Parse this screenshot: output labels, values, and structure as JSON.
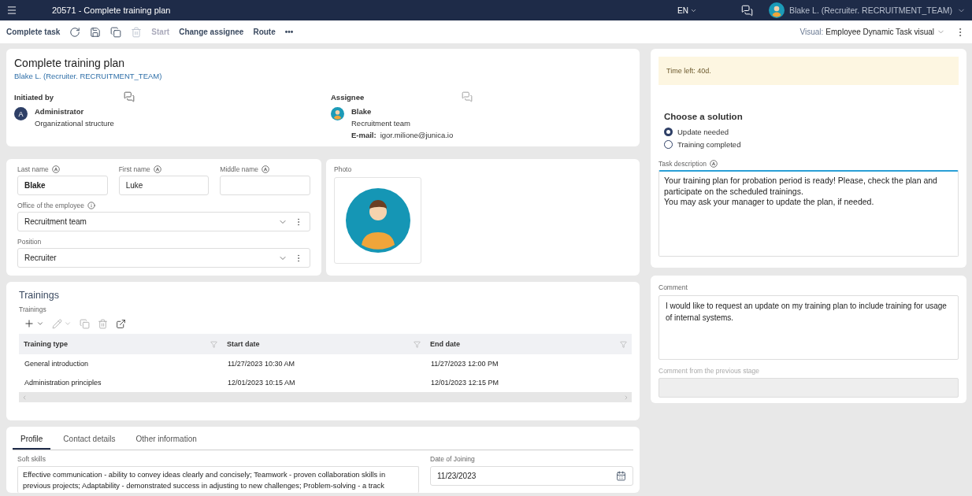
{
  "header": {
    "title": "20571 - Complete training plan",
    "language": "EN",
    "user": "Blake L. (Recruiter. RECRUITMENT_TEAM)"
  },
  "toolbar": {
    "primary": "Complete task",
    "icons": [
      {
        "disabled": false
      },
      {
        "disabled": false
      },
      {
        "disabled": false
      },
      {
        "disabled": true
      }
    ],
    "actions": [
      {
        "label": "Start",
        "disabled": true
      },
      {
        "label": "Change assignee",
        "disabled": false
      },
      {
        "label": "Route",
        "disabled": false
      }
    ],
    "more": "•••",
    "visual_label": "Visual:",
    "visual_value": "Employee Dynamic Task visual"
  },
  "task": {
    "title": "Complete training plan",
    "subtitle": "Blake L. (Recruiter. RECRUITMENT_TEAM)",
    "initiated_by": {
      "heading": "Initiated by",
      "avatar_letter": "A",
      "name": "Administrator",
      "detail": "Organizational structure"
    },
    "assignee": {
      "heading": "Assignee",
      "name": "Blake",
      "detail": "Recruitment team",
      "email_label": "E-mail:",
      "email": "igor.milione@junica.io"
    }
  },
  "employee": {
    "fields": [
      {
        "label": "Last name",
        "value": "Blake",
        "bold": true
      },
      {
        "label": "First name",
        "value": "Luke",
        "bold": false
      },
      {
        "label": "Middle name"
      }
    ],
    "selects": [
      {
        "label": "Office of the employee",
        "info": true,
        "value": "Recruitment team"
      },
      {
        "label": "Position",
        "info": false,
        "value": "Recruiter"
      }
    ],
    "photo_label": "Photo"
  },
  "trainings": {
    "title": "Trainings",
    "label": "Trainings",
    "columns": [
      "Training type",
      "Start date",
      "End date"
    ],
    "rows": [
      [
        "General introduction",
        "11/27/2023 10:30 AM",
        "11/27/2023 12:00 PM"
      ],
      [
        "Administration principles",
        "12/01/2023 10:15 AM",
        "12/01/2023 12:15 PM"
      ]
    ]
  },
  "profile": {
    "tabs": [
      {
        "label": "Profile",
        "selected": true
      },
      {
        "label": "Contact details",
        "selected": false
      },
      {
        "label": "Other information",
        "selected": false
      }
    ],
    "soft_skills": {
      "label": "Soft skills",
      "value": "Effective communication - ability to convey ideas clearly and concisely; Teamwork - proven collaboration skills in previous projects; Adaptability - demonstrated success in adjusting to new challenges; Problem-solving - a track"
    },
    "date_of_joining": {
      "label": "Date of Joining",
      "value": "11/23/2023"
    }
  },
  "side": {
    "time_left": "Time left: 40d.",
    "solution_title": "Choose a solution",
    "options": [
      {
        "label": "Update needed",
        "selected": true
      },
      {
        "label": "Training completed",
        "selected": false
      }
    ],
    "task_description": {
      "label": "Task description",
      "value": "Your training plan for probation period is ready! Please, check the plan and participate on the scheduled trainings.\nYou may ask your manager to update the plan, if needed."
    },
    "comment": {
      "label": "Comment",
      "value": "I would like to request an update on my training plan to include training for usage of internal systems."
    },
    "previous_comment": {
      "label": "Comment from the previous stage"
    }
  }
}
